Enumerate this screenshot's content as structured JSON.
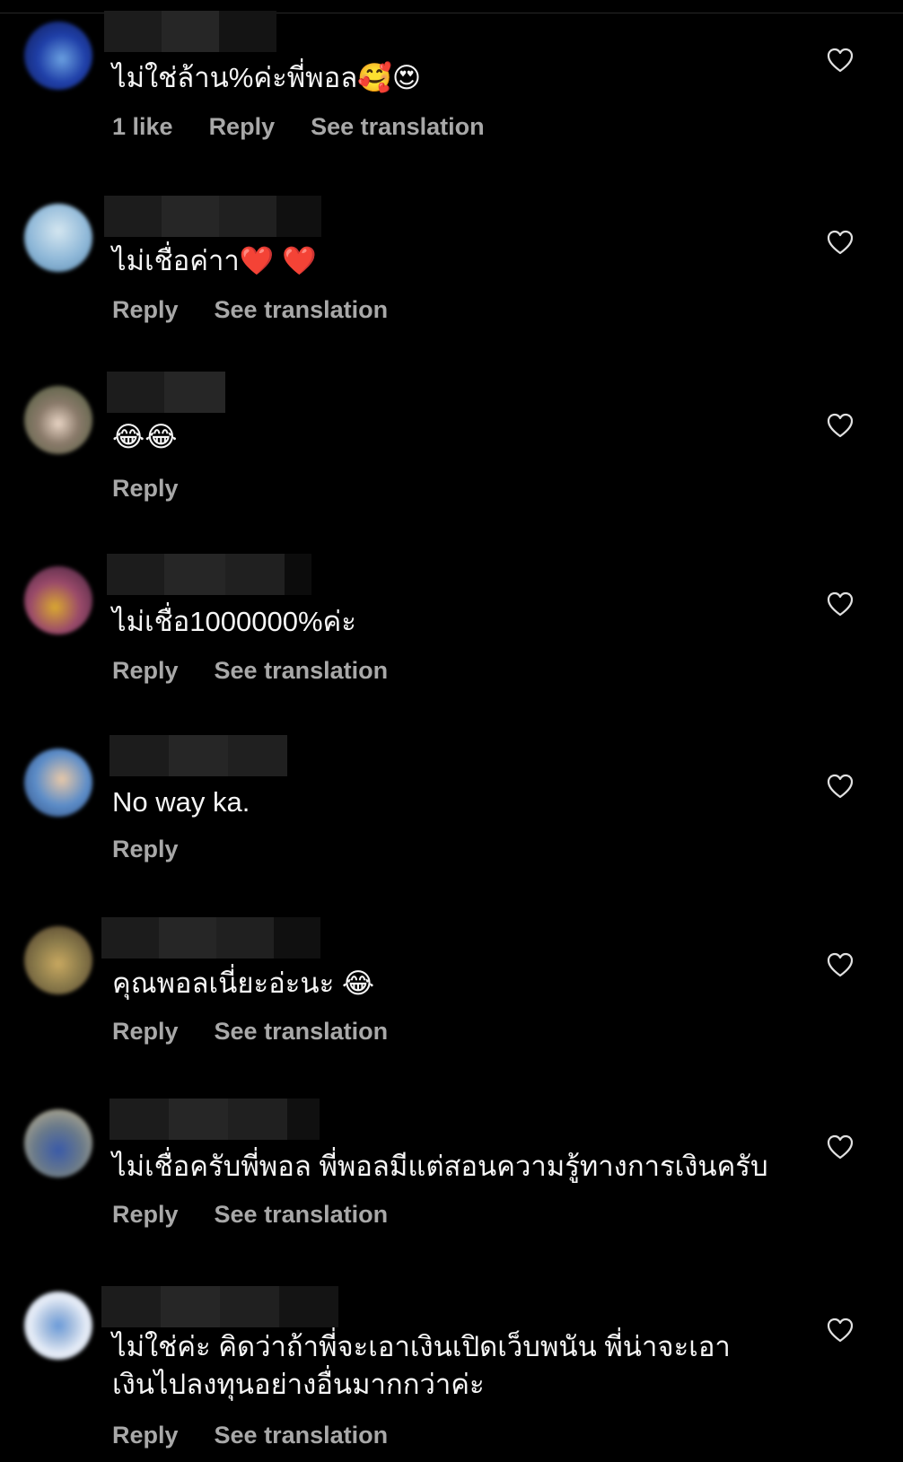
{
  "comments": [
    {
      "text": "ไม่ใช่ล้าน%ค่ะพี่พอล🥰😍",
      "likes": "1 like",
      "reply": "Reply",
      "translate": "See translation",
      "avatar_colors": [
        "#1f3fa8",
        "#6aa0e0"
      ]
    },
    {
      "text": "ไม่เชื่อค่าา❤️ ❤️",
      "reply": "Reply",
      "translate": "See translation",
      "avatar_colors": [
        "#8fb8d8",
        "#d4e6f0"
      ]
    },
    {
      "text": "😂😂",
      "reply": "Reply",
      "avatar_colors": [
        "#4a5a3a",
        "#e8d4c4"
      ]
    },
    {
      "text": "ไม่เชื่อ1000000%ค่ะ",
      "reply": "Reply",
      "translate": "See translation",
      "avatar_colors": [
        "#6a2f6a",
        "#d9a830"
      ]
    },
    {
      "text": "No way ka.",
      "reply": "Reply",
      "avatar_colors": [
        "#5b8cc8",
        "#e8c8a8"
      ]
    },
    {
      "text": "คุณพอลเนี่ยะอ่ะนะ 😂",
      "reply": "Reply",
      "translate": "See translation",
      "avatar_colors": [
        "#6a5a3a",
        "#c8a860"
      ]
    },
    {
      "text": "ไม่เชื่อครับพี่พอล พี่พอลมีแต่สอนความรู้ทางการเงินครับ",
      "reply": "Reply",
      "translate": "See translation",
      "avatar_colors": [
        "#3a5aa8",
        "#c8b890"
      ]
    },
    {
      "text": "ไม่ใช่ค่ะ คิดว่าถ้าพี่จะเอาเงินเปิดเว็บพนัน พี่น่าจะเอาเงินไปลงทุนอย่างอื่นมากกว่าค่ะ",
      "reply": "Reply",
      "translate": "See translation",
      "avatar_colors": [
        "#e8eef8",
        "#6a9ad8"
      ]
    }
  ]
}
